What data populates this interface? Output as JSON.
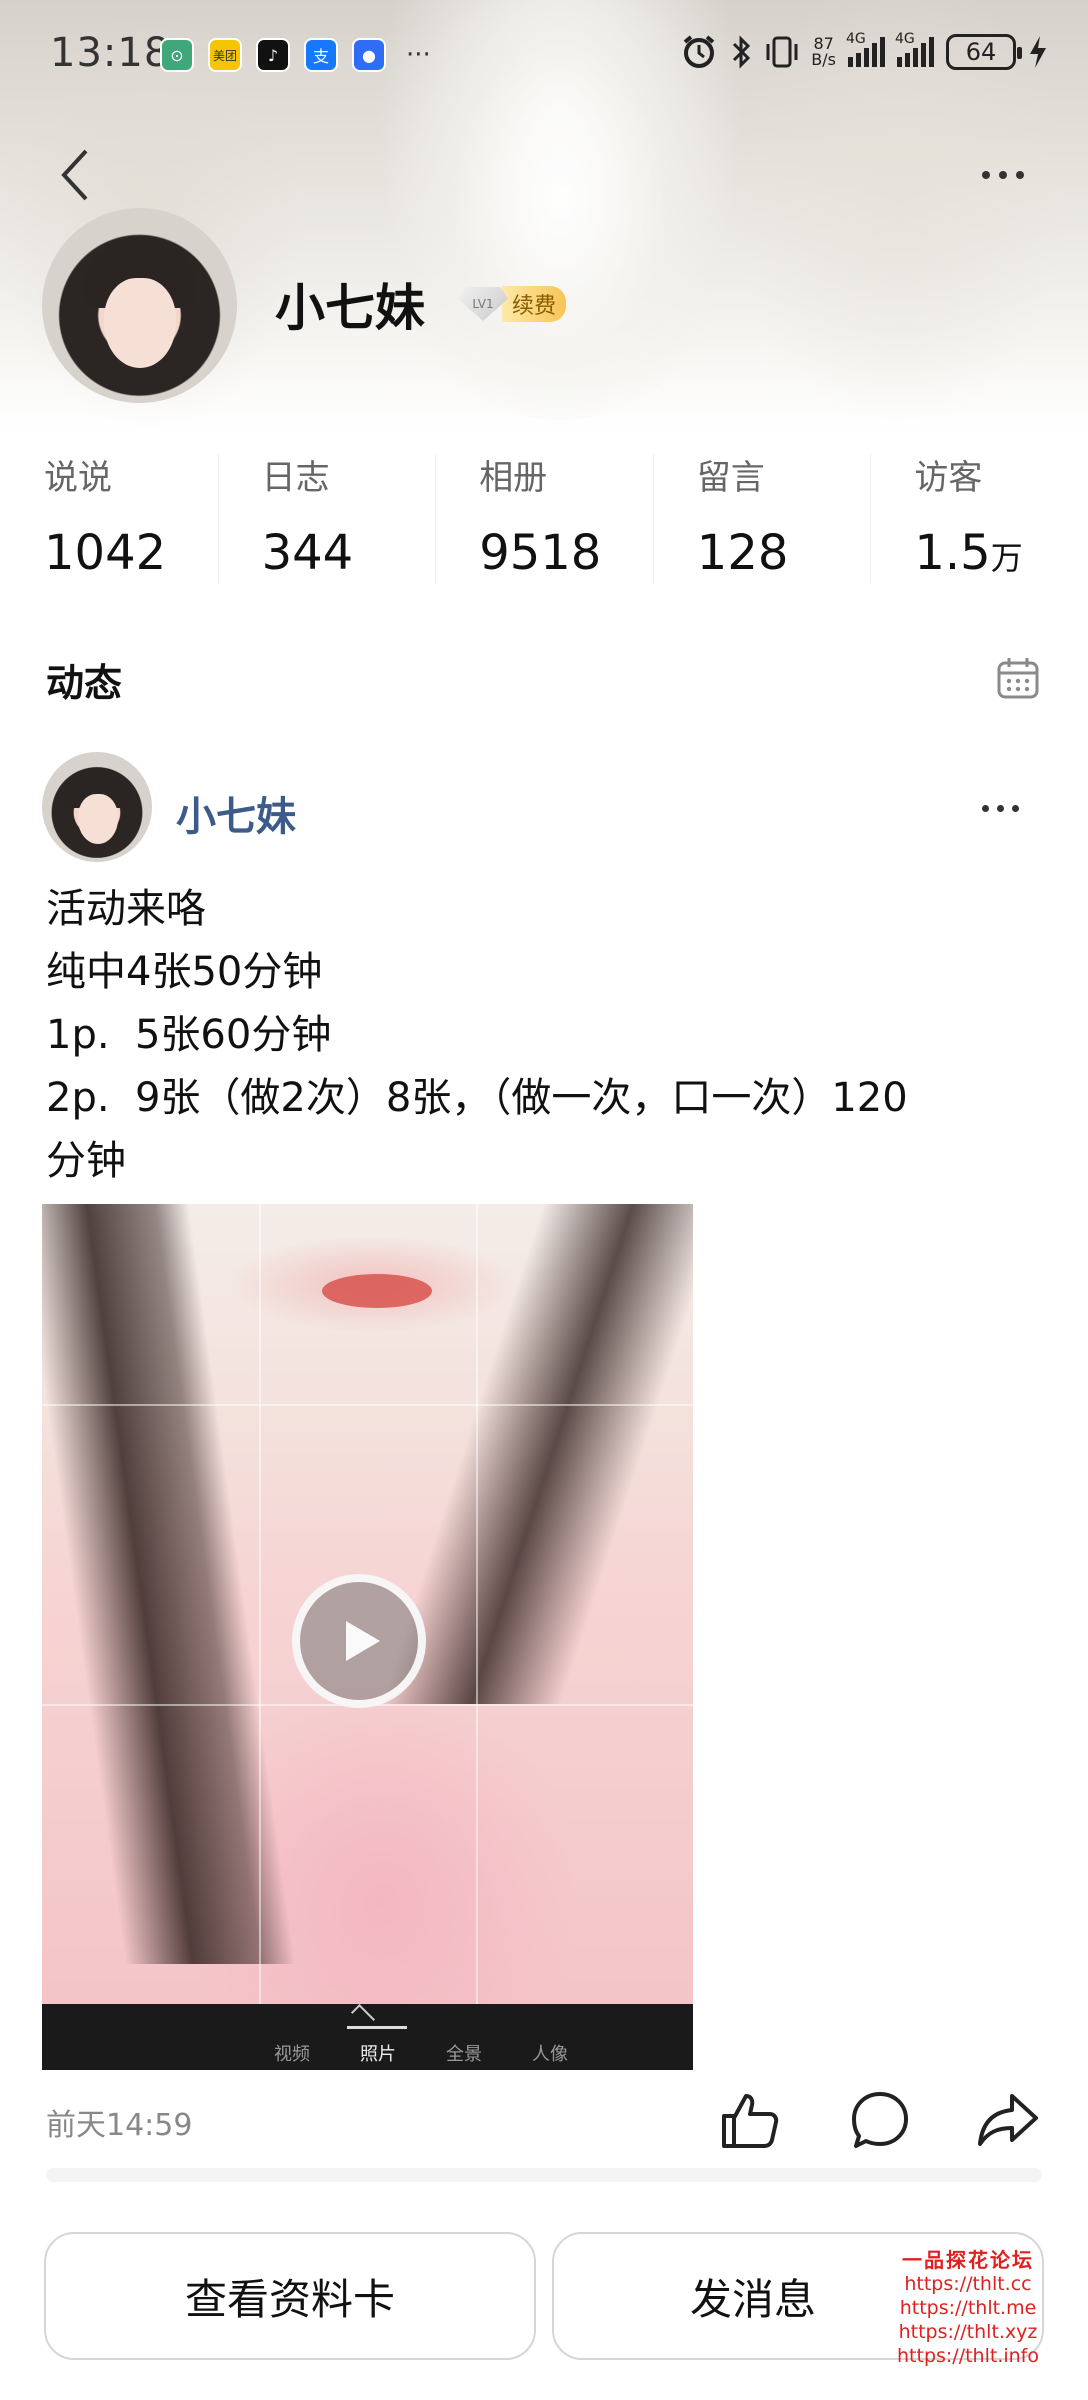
{
  "status_bar": {
    "time": "13:18",
    "apps": [
      {
        "icon": "app-green-icon",
        "color": "#3fa77a"
      },
      {
        "icon": "meituan-icon",
        "color": "#f6c500",
        "label": "美团"
      },
      {
        "icon": "tiktok-icon",
        "color": "#111111",
        "label": "♪"
      },
      {
        "icon": "alipay-icon",
        "color": "#1677ff",
        "label": "支"
      },
      {
        "icon": "message-app-icon",
        "color": "#2f6df6",
        "label": "●"
      }
    ],
    "more": "···",
    "net_speed_value": "87",
    "net_speed_unit": "B/s",
    "signal_1_label": "4G",
    "signal_2_label": "4G",
    "battery": "64"
  },
  "nav": {
    "back_icon": "chevron-left-icon",
    "more_icon": "more-horizontal-icon"
  },
  "profile": {
    "name": "小七妹",
    "vip_level": "LV1",
    "vip_action": "续费"
  },
  "stats": [
    {
      "label": "说说",
      "value": "1042",
      "unit": ""
    },
    {
      "label": "日志",
      "value": "344",
      "unit": ""
    },
    {
      "label": "相册",
      "value": "9518",
      "unit": ""
    },
    {
      "label": "留言",
      "value": "128",
      "unit": ""
    },
    {
      "label": "访客",
      "value": "1.5",
      "unit": "万"
    }
  ],
  "feed": {
    "section_title": "动态",
    "calendar_icon": "calendar-icon"
  },
  "post": {
    "author": "小七妹",
    "lines": [
      "活动来咯",
      "纯中4张50分钟",
      "1p.  5张60分钟",
      "2p.  9张（做2次）8张，（做一次，口一次）120",
      "分钟"
    ],
    "camera_modes": [
      "视频",
      "照片",
      "全景",
      "人像"
    ],
    "camera_active_mode": "照片",
    "time": "前天14:59"
  },
  "buttons": {
    "view_card": "查看资料卡",
    "send_message": "发消息"
  },
  "watermark": {
    "title": "一品探花论坛",
    "urls": [
      "https://thlt.cc",
      "https://thlt.me",
      "https://thlt.xyz",
      "https://thlt.info"
    ]
  }
}
